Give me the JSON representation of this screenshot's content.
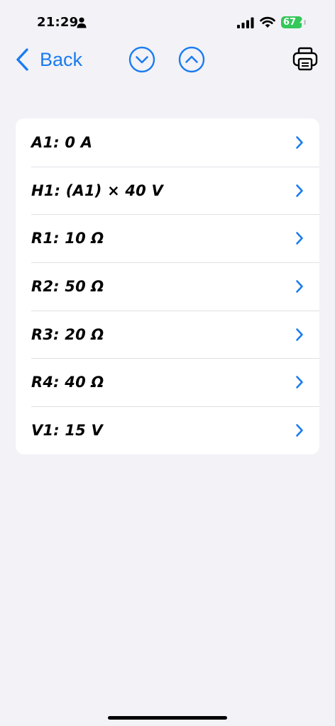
{
  "status_bar": {
    "time": "21:29",
    "battery_level": "67",
    "battery_color": "#34c759",
    "icons": [
      "person-icon",
      "signal-icon",
      "wifi-icon",
      "battery-icon"
    ]
  },
  "nav": {
    "back_label": "Back",
    "accent_color": "#1a7cf0",
    "icons": [
      "chevron-left-icon",
      "chevron-down-circle-icon",
      "chevron-up-circle-icon",
      "printer-icon"
    ]
  },
  "components": [
    {
      "label": "A1: 0 A"
    },
    {
      "label": "H1: (A1) × 40 V"
    },
    {
      "label": "R1: 10 Ω"
    },
    {
      "label": "R2: 50 Ω"
    },
    {
      "label": "R3: 20 Ω"
    },
    {
      "label": "R4: 40 Ω"
    },
    {
      "label": "V1: 15 V"
    }
  ]
}
